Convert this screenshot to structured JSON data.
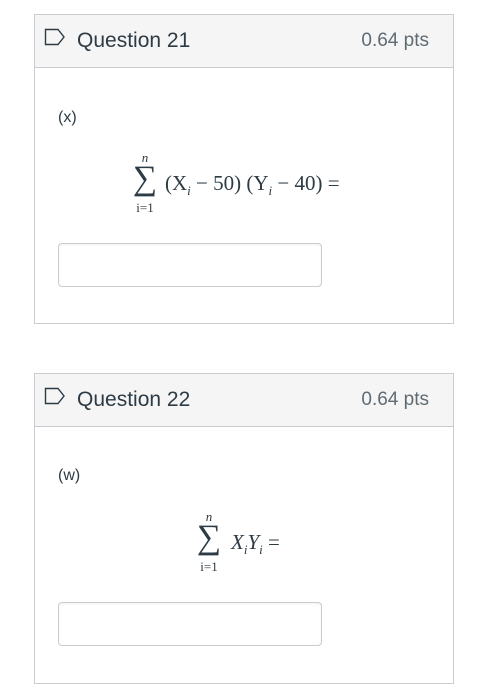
{
  "questions": [
    {
      "title": "Question 21",
      "points": "0.64 pts",
      "label": "(x)",
      "sum_upper": "n",
      "sum_lower": "i=1",
      "expression": "(X",
      "expr_parts": [
        "(X",
        "i",
        " − 50) (Y",
        "i",
        " − 40) ="
      ]
    },
    {
      "title": "Question 22",
      "points": "0.64 pts",
      "label": "(w)",
      "sum_upper": "n",
      "sum_lower": "i=1",
      "expr_parts": [
        "X",
        "i",
        "Y",
        "i",
        " ="
      ]
    }
  ],
  "icons": {
    "flag": "flag-outline-icon"
  },
  "colors": {
    "border": "#c7cdd1",
    "header_bg": "#f5f5f5",
    "text": "#2d3b45"
  }
}
